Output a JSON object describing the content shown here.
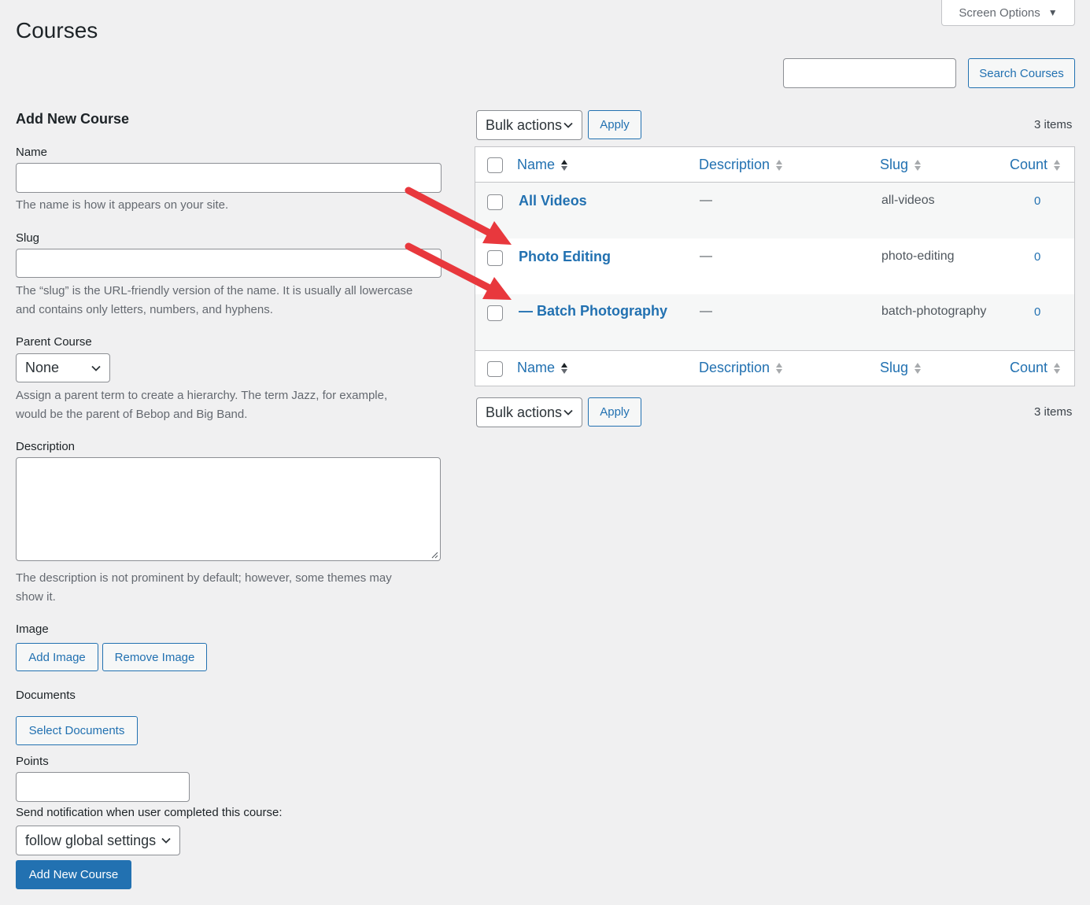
{
  "page": {
    "title": "Courses"
  },
  "screen_options": {
    "label": "Screen Options"
  },
  "search": {
    "value": "",
    "button_label": "Search Courses"
  },
  "form": {
    "title": "Add New Course",
    "name": {
      "label": "Name",
      "value": "",
      "help": "The name is how it appears on your site."
    },
    "slug": {
      "label": "Slug",
      "value": "",
      "help_line1": "The “slug” is the URL-friendly version of the name. It is usually all lowercase",
      "help_line2": "and contains only letters, numbers, and hyphens."
    },
    "parent": {
      "label": "Parent Course",
      "selected": "None",
      "help_line1": "Assign a parent term to create a hierarchy. The term Jazz, for example,",
      "help_line2": "would be the parent of Bebop and Big Band."
    },
    "description": {
      "label": "Description",
      "value": "",
      "help_line1": "The description is not prominent by default; however, some themes may",
      "help_line2": "show it."
    },
    "image": {
      "label": "Image",
      "add_label": "Add Image",
      "remove_label": "Remove Image"
    },
    "documents": {
      "label": "Documents",
      "select_label": "Select Documents"
    },
    "points": {
      "label": "Points",
      "value": ""
    },
    "notification": {
      "label": "Send notification when user completed this course:",
      "selected": "follow global settings"
    },
    "submit_label": "Add New Course"
  },
  "table": {
    "bulk_actions_label": "Bulk actions",
    "apply_label": "Apply",
    "items_count": "3 items",
    "columns": {
      "name": "Name",
      "description": "Description",
      "slug": "Slug",
      "count": "Count"
    },
    "rows": [
      {
        "name": "All Videos",
        "description": "—",
        "slug": "all-videos",
        "count": "0"
      },
      {
        "name": "Photo Editing",
        "description": "—",
        "slug": "photo-editing",
        "count": "0"
      },
      {
        "name": "— Batch Photography",
        "description": "—",
        "slug": "batch-photography",
        "count": "0"
      }
    ]
  },
  "annotations": {
    "arrow_color": "#e8383d"
  },
  "colors": {
    "accent": "#2271b1",
    "background": "#f0f0f1"
  }
}
